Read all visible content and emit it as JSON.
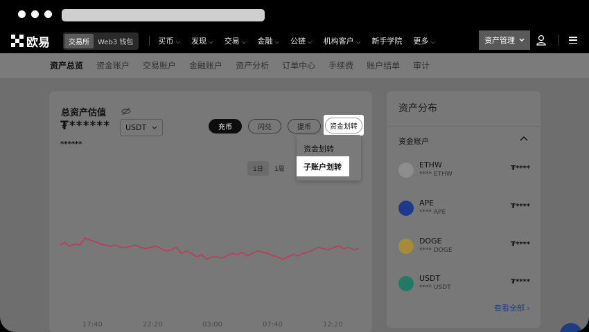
{
  "browser": {
    "address": ""
  },
  "brand": {
    "name": "欧易"
  },
  "mode_switch": {
    "exchange": "交易所",
    "web3": "Web3 钱包"
  },
  "top_menu": [
    "买币",
    "发现",
    "交易",
    "金融",
    "公链",
    "机构客户",
    "新手学院",
    "更多"
  ],
  "top_menu_has_arrow": [
    true,
    true,
    true,
    true,
    true,
    true,
    false,
    true
  ],
  "asset_mgmt": {
    "label": "资产管理"
  },
  "sub_nav": [
    "资产总览",
    "资金账户",
    "交易账户",
    "金融账户",
    "资产分析",
    "订单中心",
    "手续费",
    "账户结单",
    "审计"
  ],
  "overview": {
    "title": "总资产估值",
    "total_value": "₮******",
    "sub_value": "******",
    "currency": "USDT",
    "actions": {
      "deposit": "充币",
      "convert": "闪兑",
      "withdraw": "提币",
      "transfer": "资金划转"
    },
    "range": {
      "day": "1日",
      "week": "1周"
    }
  },
  "transfer_menu": {
    "item1": "资金划转",
    "item2": "子账户划转"
  },
  "chart_data": {
    "type": "line",
    "x_ticks": [
      "17:40",
      "22:20",
      "03:00",
      "07:40",
      "12:20"
    ],
    "values": [
      62,
      64,
      61,
      63,
      62,
      68,
      66,
      65,
      63,
      62,
      61,
      62,
      60,
      60,
      61,
      62,
      60,
      59,
      60,
      61,
      59,
      57,
      58,
      60,
      55,
      57,
      55,
      52,
      54,
      50,
      52,
      52,
      51,
      53,
      55,
      54,
      56,
      53,
      55,
      57,
      56,
      55,
      53,
      52,
      50,
      52,
      54,
      53,
      55,
      56,
      58,
      60,
      59,
      58,
      60,
      61,
      59,
      60,
      58,
      59
    ],
    "color": "#c0395a"
  },
  "distribution": {
    "title": "资产分布",
    "account_title": "资金账户",
    "coins": [
      {
        "symbol": "ETHW",
        "sub": "**** ETHW",
        "amount": "₮****",
        "icon": "ethw-icon",
        "color": "#8d8d8d"
      },
      {
        "symbol": "APE",
        "sub": "**** APE",
        "amount": "₮****",
        "icon": "ape-icon",
        "color": "#1b3a8c"
      },
      {
        "symbol": "DOGE",
        "sub": "**** DOGE",
        "amount": "₮****",
        "icon": "doge-icon",
        "color": "#a78a3a"
      },
      {
        "symbol": "USDT",
        "sub": "**** USDT",
        "amount": "₮****",
        "icon": "tether-icon",
        "color": "#1f7a66"
      }
    ],
    "view_all": "查看全部 ›"
  }
}
